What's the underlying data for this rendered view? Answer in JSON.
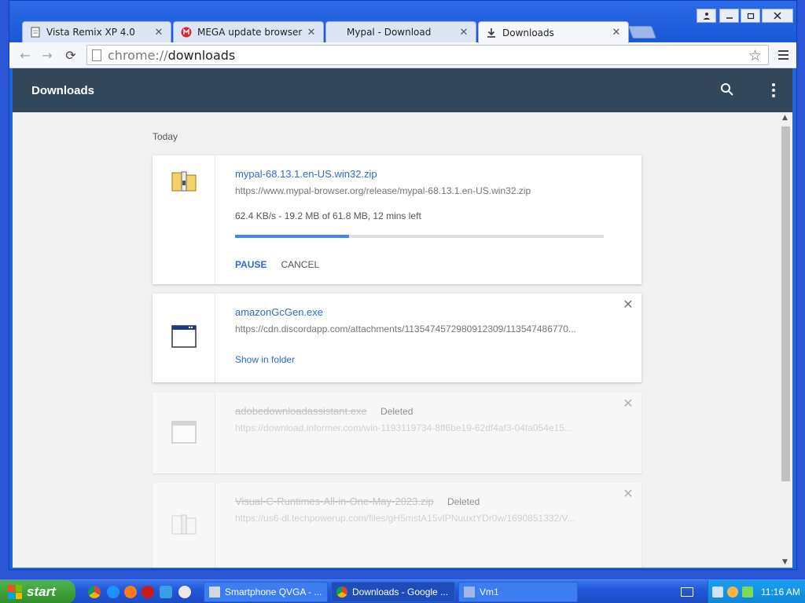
{
  "browser": {
    "tabs": [
      {
        "label": "Vista Remix XP 4.0",
        "icon": "page-icon"
      },
      {
        "label": "MEGA update browser",
        "icon": "mega-icon"
      },
      {
        "label": "Mypal - Download",
        "icon": ""
      },
      {
        "label": "Downloads",
        "icon": "download-icon"
      }
    ],
    "address": {
      "scheme": "chrome://",
      "path": "downloads"
    }
  },
  "page": {
    "title": "Downloads",
    "date_group": "Today"
  },
  "downloads": [
    {
      "name": "mypal-68.13.1.en-US.win32.zip",
      "url": "https://www.mypal-browser.org/release/mypal-68.13.1.en-US.win32.zip",
      "status": "62.4 KB/s - 19.2 MB of 61.8 MB, 12 mins left",
      "progress_fraction": 0.31,
      "pause_label": "PAUSE",
      "cancel_label": "CANCEL"
    },
    {
      "name": "amazonGcGen.exe",
      "url": "https://cdn.discordapp.com/attachments/1135474572980912309/113547486770...",
      "show_label": "Show in folder"
    },
    {
      "name": "adobedownloadassistant.exe",
      "badge": "Deleted",
      "url": "https://download.informer.com/win-1193119734-8ff6be19-62df4af3-04fa054e15..."
    },
    {
      "name": "Visual-C-Runtimes-All-in-One-May-2023.zip",
      "badge": "Deleted",
      "url": "https://us6-dl.techpowerup.com/files/gH5mstA15vIPNuuxtYDr0w/1690851332/V..."
    }
  ],
  "taskbar": {
    "start_label": "start",
    "tasks": [
      {
        "label": "Smartphone QVGA - ..."
      },
      {
        "label": "Downloads - Google ..."
      },
      {
        "label": "Vm1"
      }
    ],
    "clock": "11:16 AM"
  }
}
